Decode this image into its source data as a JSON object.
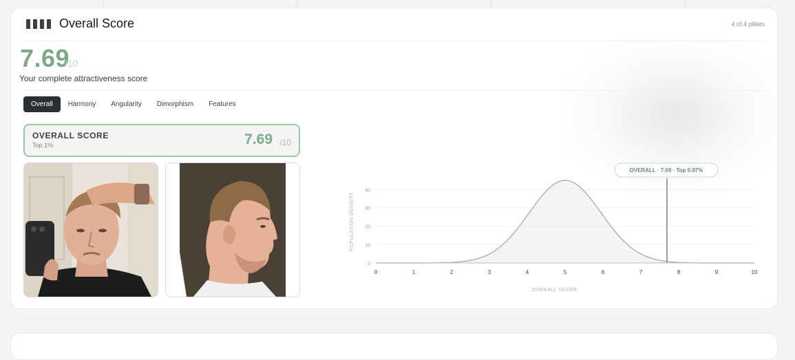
{
  "card": {
    "title": "Overall Score",
    "pillars": "4 of 4 pillars",
    "score": "7.69",
    "denom": "/10",
    "subtitle": "Your complete attractiveness score"
  },
  "tabs": [
    {
      "label": "Overall",
      "active": true
    },
    {
      "label": "Harmony",
      "active": false
    },
    {
      "label": "Angularity",
      "active": false
    },
    {
      "label": "Dimorphism",
      "active": false
    },
    {
      "label": "Features",
      "active": false
    }
  ],
  "score_card": {
    "label": "OVERALL SCORE",
    "top": "Top 1%",
    "value": "7.69",
    "denom": "/10"
  },
  "colors": {
    "accent_green": "#7fa88a",
    "dark_tab": "#2a2f33"
  },
  "chart_data": {
    "type": "area",
    "xlabel": "OVERALL SCORE",
    "ylabel": "POPULATION DENSITY",
    "xlim": [
      0,
      10
    ],
    "ylim": [
      0,
      45
    ],
    "xticks": [
      "0",
      "1",
      "2",
      "3",
      "4",
      "5",
      "6",
      "7",
      "8",
      "9",
      "10"
    ],
    "yticks": [
      "0",
      "10",
      "20",
      "30",
      "40"
    ],
    "distribution": {
      "mean": 5,
      "std": 0.95,
      "peak": 45
    },
    "marker": {
      "x": 7.69,
      "label": "OVERALL · 7.69 · Top 0.97%"
    }
  }
}
